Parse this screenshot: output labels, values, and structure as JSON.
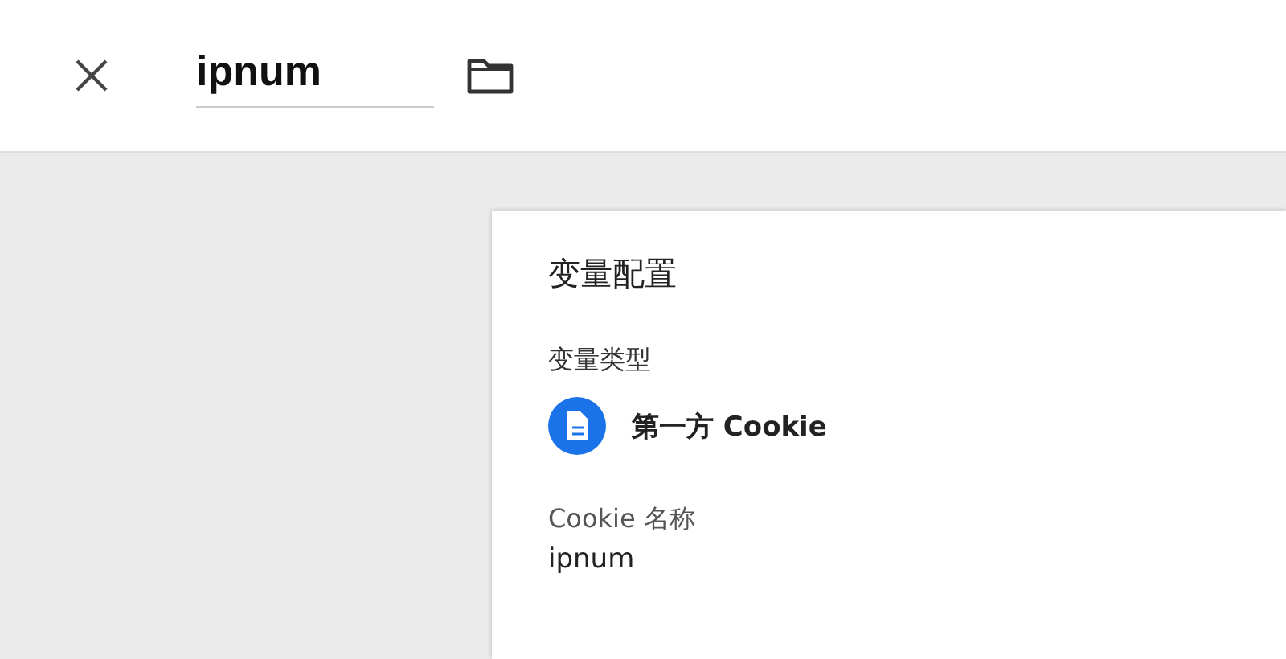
{
  "header": {
    "name_value": "ipnum"
  },
  "card": {
    "title": "变量配置",
    "type_label": "变量类型",
    "type": {
      "name": "第一方 Cookie"
    },
    "fields": [
      {
        "label": "Cookie 名称",
        "value": "ipnum"
      }
    ]
  }
}
